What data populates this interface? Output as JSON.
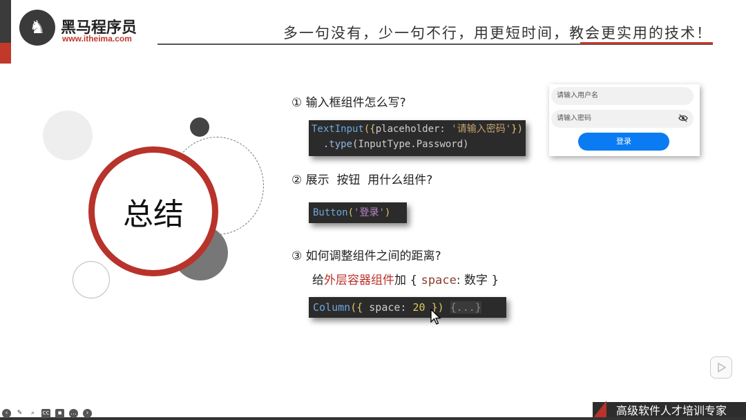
{
  "header": {
    "logo_glyph": "♞",
    "logo_name": "黑马程序员",
    "logo_url": "www.itheima.com",
    "slogan": "多一句没有，少一句不行，用更短时间，教会更实用的技术！"
  },
  "summary": {
    "title": "总结"
  },
  "questions": [
    {
      "number": "①",
      "text": "输入框组件怎么写?"
    },
    {
      "number": "②",
      "text": "展示  按钮  用什么组件?"
    },
    {
      "number": "③",
      "text": "如何调整组件之间的距离?"
    }
  ],
  "code1": {
    "line1_fn": "TextInput",
    "line1_open": "({",
    "line1_key": "placeholder: ",
    "line1_str": "'请输入密码'",
    "line1_close": "})",
    "line2_indent": "  .",
    "line2_method": "type",
    "line2_arg": "(InputType.Password)"
  },
  "code2": {
    "fn": "Button",
    "open": "(",
    "str": "'登录'",
    "close": ")"
  },
  "q3_sub": {
    "prefix": "给",
    "highlight": "外层容器组件",
    "middle": "加 { ",
    "keyword": "space",
    "suffix": ": 数字 }"
  },
  "code3": {
    "fn": "Column",
    "open": "({ ",
    "key": "space: ",
    "num": "20",
    "close": " })",
    "fold": "{...}"
  },
  "login_preview": {
    "user_placeholder": "请输入用户名",
    "pass_placeholder": "请输入密码",
    "button_label": "登录"
  },
  "footer": {
    "tag": "高级软件人才培训专家"
  },
  "toolbar_icons": [
    "prev-icon",
    "pen-icon",
    "search-icon",
    "cc-icon",
    "video-icon",
    "more-icon",
    "next-icon"
  ],
  "colors": {
    "brand_red": "#b8332b",
    "button_blue": "#0a7bf2"
  }
}
